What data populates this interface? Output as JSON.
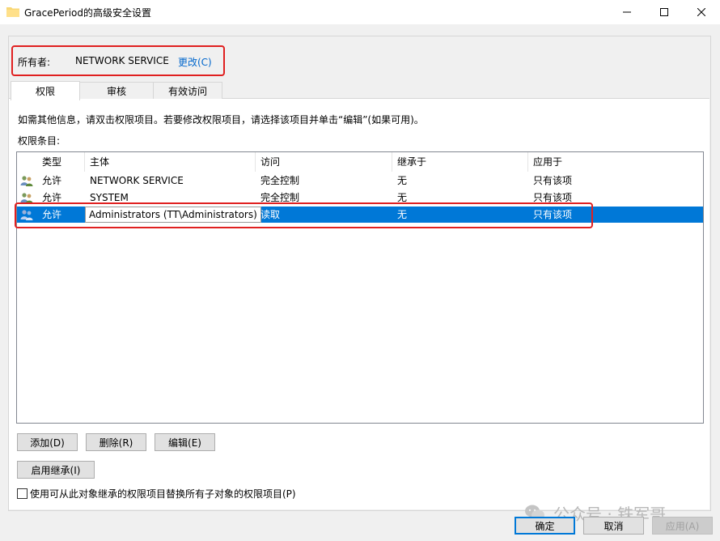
{
  "window": {
    "title": "GracePeriod的高级安全设置",
    "icons": {
      "app": "folder-icon",
      "minimize": "minimize-icon",
      "maximize": "maximize-icon",
      "close": "close-icon"
    }
  },
  "owner": {
    "label": "所有者:",
    "value": "NETWORK SERVICE",
    "change_link": "更改(C)"
  },
  "tabs": [
    {
      "label": "权限",
      "active": true
    },
    {
      "label": "审核",
      "active": false
    },
    {
      "label": "有效访问",
      "active": false
    }
  ],
  "info_text": "如需其他信息，请双击权限项目。若要修改权限项目，请选择该项目并单击“编辑”(如果可用)。",
  "entries_label": "权限条目:",
  "table": {
    "columns": [
      "类型",
      "主体",
      "访问",
      "继承于",
      "应用于"
    ],
    "rows": [
      {
        "type": "允许",
        "principal": "NETWORK SERVICE",
        "access": "完全控制",
        "inherited_from": "无",
        "applies_to": "只有该项",
        "selected": false,
        "icon": "users-icon"
      },
      {
        "type": "允许",
        "principal": "SYSTEM",
        "access": "完全控制",
        "inherited_from": "无",
        "applies_to": "只有该项",
        "selected": false,
        "icon": "users-icon"
      },
      {
        "type": "允许",
        "principal": "Administrators (TT\\Administrators)",
        "access": "读取",
        "inherited_from": "无",
        "applies_to": "只有该项",
        "selected": true,
        "icon": "users-icon"
      }
    ]
  },
  "buttons": {
    "add": "添加(D)",
    "remove": "删除(R)",
    "edit": "编辑(E)",
    "enable_inheritance": "启用继承(I)"
  },
  "replace_checkbox": {
    "label": "使用可从此对象继承的权限项目替换所有子对象的权限项目(P)",
    "checked": false
  },
  "footer": {
    "ok": "确定",
    "cancel": "取消",
    "apply": "应用(A)"
  },
  "watermark": "公众号 · 铁军哥",
  "colors": {
    "selection": "#0078d7",
    "link": "#0066cc",
    "highlight_border": "#e02020"
  }
}
